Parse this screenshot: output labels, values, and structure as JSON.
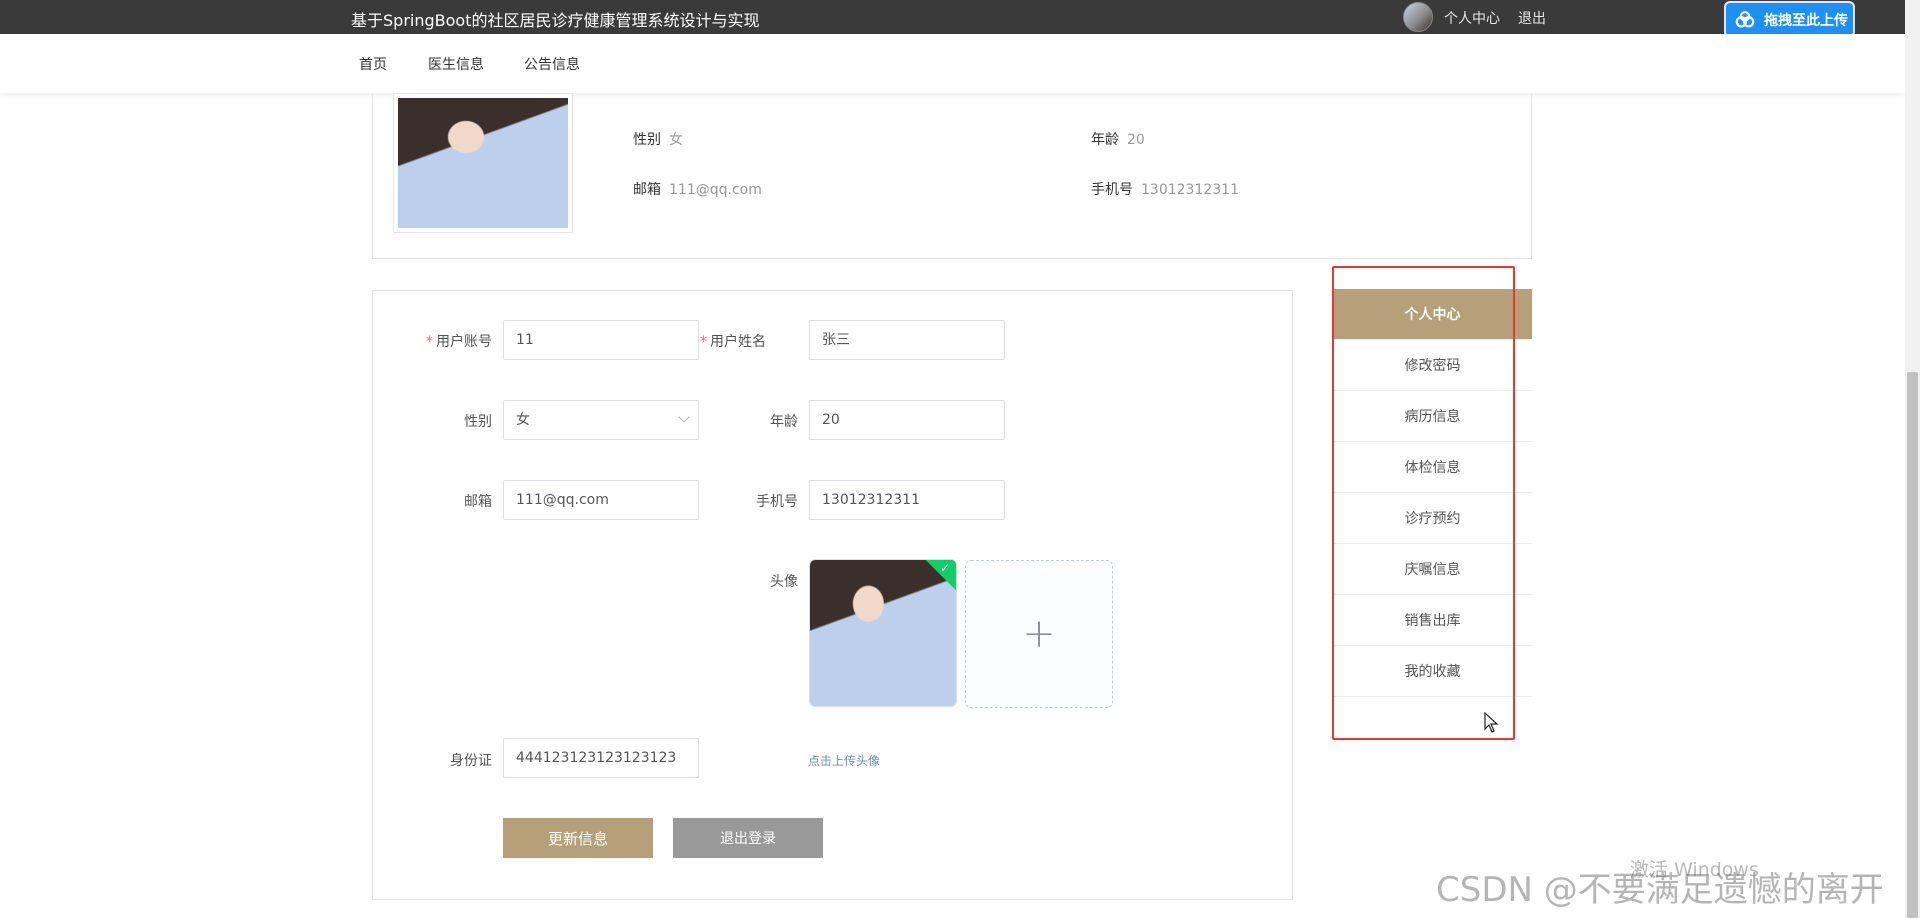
{
  "header": {
    "title": "基于SpringBoot的社区居民诊疗健康管理系统设计与实现",
    "links": [
      "个人中心",
      "退出"
    ]
  },
  "upload_widget": {
    "label": "拖拽至此上传"
  },
  "nav": {
    "items": [
      "首页",
      "医生信息",
      "公告信息"
    ]
  },
  "profile": {
    "gender_label": "性别",
    "gender_value": "女",
    "age_label": "年龄",
    "age_value": "20",
    "email_label": "邮箱",
    "email_value": "111@qq.com",
    "phone_label": "手机号",
    "phone_value": "13012312311"
  },
  "form": {
    "account_label": "用户账号",
    "account_value": "11",
    "name_label": "用户姓名",
    "name_value": "张三",
    "gender_label": "性别",
    "gender_value": "女",
    "age_label": "年龄",
    "age_value": "20",
    "email_label": "邮箱",
    "email_value": "111@qq.com",
    "phone_label": "手机号",
    "phone_value": "13012312311",
    "avatar_label": "头像",
    "upload_tip": "点击上传头像",
    "idcard_label": "身份证",
    "idcard_value": "444123123123123123",
    "update_button": "更新信息",
    "logout_button": "退出登录"
  },
  "sidemenu": {
    "items": [
      "个人中心",
      "修改密码",
      "病历信息",
      "体检信息",
      "诊疗预约",
      "庆嘱信息",
      "销售出库",
      "我的收藏"
    ],
    "active_index": 0
  },
  "watermark": {
    "activate": "激活 Windows",
    "csdn": "CSDN @不要满足遗憾的离开"
  },
  "colors": {
    "accent": "#b5a07a",
    "topbar": "#3a3a3a",
    "highlight_box": "#e53935"
  }
}
